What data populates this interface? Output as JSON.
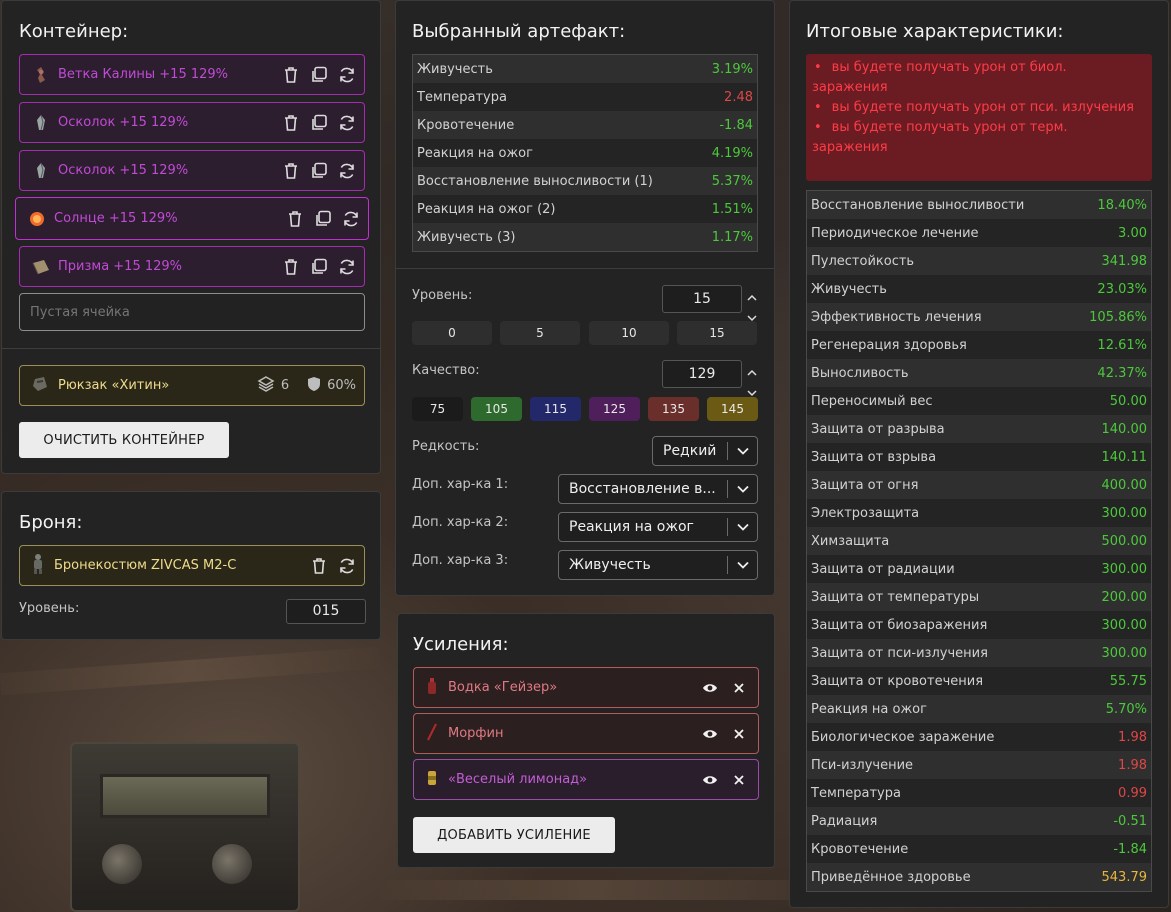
{
  "container": {
    "title": "Контейнер:",
    "slots": [
      {
        "name": "Ветка Калины +15 129%"
      },
      {
        "name": "Осколок +15 129%"
      },
      {
        "name": "Осколок +15 129%"
      },
      {
        "name": "Солнце +15 129%"
      },
      {
        "name": "Призма +15 129%"
      }
    ],
    "empty_placeholder": "Пустая ячейка",
    "backpack": {
      "name": "Рюкзак «Хитин»",
      "slots": "6",
      "reduction": "60%"
    },
    "clear_button": "ОЧИСТИТЬ КОНТЕЙНЕР"
  },
  "armor": {
    "title": "Броня:",
    "name": "Бронекостюм ZIVCAS M2-C",
    "level_label": "Уровень:",
    "level_value": "015"
  },
  "artifact": {
    "title": "Выбранный артефакт:",
    "stats": [
      {
        "k": "Живучесть",
        "v": "3.19%",
        "c": "pos"
      },
      {
        "k": "Температура",
        "v": "2.48",
        "c": "neg"
      },
      {
        "k": "Кровотечение",
        "v": "-1.84",
        "c": "pos"
      },
      {
        "k": "Реакция на ожог",
        "v": "4.19%",
        "c": "pos"
      },
      {
        "k": "Восстановление выносливости (1)",
        "v": "5.37%",
        "c": "pos"
      },
      {
        "k": "Реакция на ожог (2)",
        "v": "1.51%",
        "c": "pos"
      },
      {
        "k": "Живучесть (3)",
        "v": "1.17%",
        "c": "pos"
      }
    ],
    "level_label": "Уровень:",
    "level_value": "15",
    "level_presets": [
      "0",
      "5",
      "10",
      "15"
    ],
    "quality_label": "Качество:",
    "quality_value": "129",
    "quality_presets": [
      {
        "v": "75",
        "color": "#1b1b1b"
      },
      {
        "v": "105",
        "color": "#2e6a2e"
      },
      {
        "v": "115",
        "color": "#22286a"
      },
      {
        "v": "125",
        "color": "#4f1f5c"
      },
      {
        "v": "135",
        "color": "#6b2f2b"
      },
      {
        "v": "145",
        "color": "#6a5a14"
      }
    ],
    "rarity_label": "Редкость:",
    "rarity_value": "Редкий",
    "extra1_label": "Доп. хар-ка 1:",
    "extra1_value": "Восстановление в...",
    "extra2_label": "Доп. хар-ка 2:",
    "extra2_value": "Реакция на ожог",
    "extra3_label": "Доп. хар-ка 3:",
    "extra3_value": "Живучесть"
  },
  "boosts": {
    "title": "Усиления:",
    "items": [
      {
        "name": "Водка «Гейзер»",
        "border": "#b35a5e",
        "bg": "#2c1f20",
        "color": "#e07a82"
      },
      {
        "name": "Морфин",
        "border": "#b35a5e",
        "bg": "#2c1f20",
        "color": "#e07a82"
      },
      {
        "name": "«Веселый лимонад»",
        "border": "#9a4da7",
        "bg": "#2a1e2d",
        "color": "#c25ed3"
      }
    ],
    "add_button": "ДОБАВИТЬ УСИЛЕНИЕ"
  },
  "totals": {
    "title": "Итоговые характеристики:",
    "warnings": [
      "вы будете получать урон от биол. заражения",
      "вы будете получать урон от пси. излучения",
      "вы будете получать урон от терм. заражения"
    ],
    "stats": [
      {
        "k": "Восстановление выносливости",
        "v": "18.40%",
        "c": "pos"
      },
      {
        "k": "Периодическое лечение",
        "v": "3.00",
        "c": "pos"
      },
      {
        "k": "Пулестойкость",
        "v": "341.98",
        "c": "pos"
      },
      {
        "k": "Живучесть",
        "v": "23.03%",
        "c": "pos"
      },
      {
        "k": "Эффективность лечения",
        "v": "105.86%",
        "c": "pos"
      },
      {
        "k": "Регенерация здоровья",
        "v": "12.61%",
        "c": "pos"
      },
      {
        "k": "Выносливость",
        "v": "42.37%",
        "c": "pos"
      },
      {
        "k": "Переносимый вес",
        "v": "50.00",
        "c": "pos"
      },
      {
        "k": "Защита от разрыва",
        "v": "140.00",
        "c": "pos"
      },
      {
        "k": "Защита от взрыва",
        "v": "140.11",
        "c": "pos"
      },
      {
        "k": "Защита от огня",
        "v": "400.00",
        "c": "pos"
      },
      {
        "k": "Электрозащита",
        "v": "300.00",
        "c": "pos"
      },
      {
        "k": "Химзащита",
        "v": "500.00",
        "c": "pos"
      },
      {
        "k": "Защита от радиации",
        "v": "300.00",
        "c": "pos"
      },
      {
        "k": "Защита от температуры",
        "v": "200.00",
        "c": "pos"
      },
      {
        "k": "Защита от биозаражения",
        "v": "300.00",
        "c": "pos"
      },
      {
        "k": "Защита от пси-излучения",
        "v": "300.00",
        "c": "pos"
      },
      {
        "k": "Защита от кровотечения",
        "v": "55.75",
        "c": "pos"
      },
      {
        "k": "Реакция на ожог",
        "v": "5.70%",
        "c": "pos"
      },
      {
        "k": "Биологическое заражение",
        "v": "1.98",
        "c": "neg"
      },
      {
        "k": "Пси-излучение",
        "v": "1.98",
        "c": "neg"
      },
      {
        "k": "Температура",
        "v": "0.99",
        "c": "neg"
      },
      {
        "k": "Радиация",
        "v": "-0.51",
        "c": "pos"
      },
      {
        "k": "Кровотечение",
        "v": "-1.84",
        "c": "pos"
      },
      {
        "k": "Приведённое здоровье",
        "v": "543.79",
        "c": "gold"
      }
    ]
  }
}
